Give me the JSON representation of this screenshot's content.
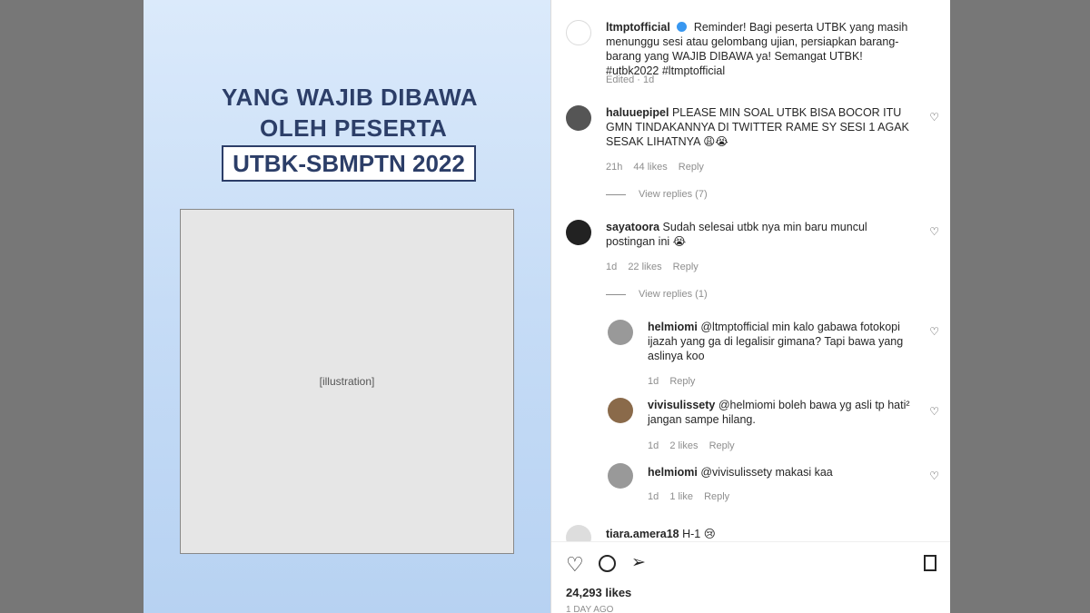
{
  "post": {
    "headline_line1": "YANG WAJIB DIBAWA",
    "headline_line2": "OLEH PESERTA",
    "headline_box": "UTBK-SBMPTN 2022",
    "placeholder": "[illustration]"
  },
  "caption": {
    "username": "ltmptofficial",
    "text": "Reminder! Bagi peserta UTBK yang masih menunggu sesi atau gelombang ujian, persiapkan barang-barang yang WAJIB DIBAWA ya! Semangat UTBK! #utbk2022 #ltmptofficial",
    "meta": "Edited · 1d"
  },
  "comments": [
    {
      "user": "haluuepipel",
      "text": "PLEASE MIN SOAL UTBK BISA BOCOR ITU GMN TINDAKANNYA DI TWITTER RAME SY SESI 1 AGAK SESAK LIHATNYA 😩😭",
      "time": "21h",
      "likes": "44 likes",
      "reply": "Reply",
      "view": "View replies (7)"
    },
    {
      "user": "sayatoora",
      "text": "Sudah selesai utbk nya min baru muncul postingan ini 😭",
      "time": "1d",
      "likes": "22 likes",
      "reply": "Reply",
      "view": "View replies (1)"
    }
  ],
  "replies": [
    {
      "user": "helmiomi",
      "text": "@ltmptofficial min kalo gabawa fotokopi ijazah yang ga di legalisir gimana? Tapi bawa yang aslinya koo",
      "time": "1d",
      "likes": "",
      "reply": "Reply"
    },
    {
      "user": "vivisulissety",
      "text": "@helmiomi boleh bawa yg asli tp hati² jangan sampe hilang.",
      "time": "1d",
      "likes": "2 likes",
      "reply": "Reply"
    },
    {
      "user": "helmiomi",
      "text": "@vivisulissety makasi kaa",
      "time": "1d",
      "likes": "1 like",
      "reply": "Reply"
    }
  ],
  "last_comment": {
    "user": "tiara.amera18",
    "text": "H-1 😢"
  },
  "stats": {
    "likes": "24,293 likes",
    "date": "1 DAY AGO"
  }
}
